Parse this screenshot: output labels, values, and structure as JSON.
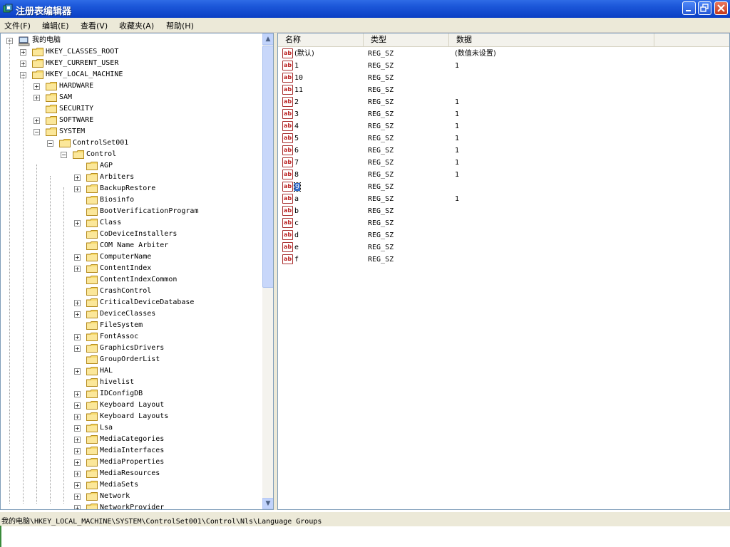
{
  "window": {
    "title": "注册表编辑器"
  },
  "menu": [
    "文件(F)",
    "编辑(E)",
    "查看(V)",
    "收藏夹(A)",
    "帮助(H)"
  ],
  "tree": [
    {
      "label": "我的电脑",
      "depth": 0,
      "exp": "-"
    },
    {
      "label": "HKEY_CLASSES_ROOT",
      "depth": 1,
      "exp": "+"
    },
    {
      "label": "HKEY_CURRENT_USER",
      "depth": 1,
      "exp": "+"
    },
    {
      "label": "HKEY_LOCAL_MACHINE",
      "depth": 1,
      "exp": "-"
    },
    {
      "label": "HARDWARE",
      "depth": 2,
      "exp": "+"
    },
    {
      "label": "SAM",
      "depth": 2,
      "exp": "+"
    },
    {
      "label": "SECURITY",
      "depth": 2,
      "exp": ""
    },
    {
      "label": "SOFTWARE",
      "depth": 2,
      "exp": "+"
    },
    {
      "label": "SYSTEM",
      "depth": 2,
      "exp": "-"
    },
    {
      "label": "ControlSet001",
      "depth": 3,
      "exp": "-"
    },
    {
      "label": "Control",
      "depth": 4,
      "exp": "-"
    },
    {
      "label": "AGP",
      "depth": 5,
      "exp": ""
    },
    {
      "label": "Arbiters",
      "depth": 5,
      "exp": "+"
    },
    {
      "label": "BackupRestore",
      "depth": 5,
      "exp": "+"
    },
    {
      "label": "Biosinfo",
      "depth": 5,
      "exp": ""
    },
    {
      "label": "BootVerificationProgram",
      "depth": 5,
      "exp": ""
    },
    {
      "label": "Class",
      "depth": 5,
      "exp": "+"
    },
    {
      "label": "CoDeviceInstallers",
      "depth": 5,
      "exp": ""
    },
    {
      "label": "COM Name Arbiter",
      "depth": 5,
      "exp": ""
    },
    {
      "label": "ComputerName",
      "depth": 5,
      "exp": "+"
    },
    {
      "label": "ContentIndex",
      "depth": 5,
      "exp": "+"
    },
    {
      "label": "ContentIndexCommon",
      "depth": 5,
      "exp": ""
    },
    {
      "label": "CrashControl",
      "depth": 5,
      "exp": ""
    },
    {
      "label": "CriticalDeviceDatabase",
      "depth": 5,
      "exp": "+"
    },
    {
      "label": "DeviceClasses",
      "depth": 5,
      "exp": "+"
    },
    {
      "label": "FileSystem",
      "depth": 5,
      "exp": ""
    },
    {
      "label": "FontAssoc",
      "depth": 5,
      "exp": "+"
    },
    {
      "label": "GraphicsDrivers",
      "depth": 5,
      "exp": "+"
    },
    {
      "label": "GroupOrderList",
      "depth": 5,
      "exp": ""
    },
    {
      "label": "HAL",
      "depth": 5,
      "exp": "+"
    },
    {
      "label": "hivelist",
      "depth": 5,
      "exp": ""
    },
    {
      "label": "IDConfigDB",
      "depth": 5,
      "exp": "+"
    },
    {
      "label": "Keyboard Layout",
      "depth": 5,
      "exp": "+"
    },
    {
      "label": "Keyboard Layouts",
      "depth": 5,
      "exp": "+"
    },
    {
      "label": "Lsa",
      "depth": 5,
      "exp": "+"
    },
    {
      "label": "MediaCategories",
      "depth": 5,
      "exp": "+"
    },
    {
      "label": "MediaInterfaces",
      "depth": 5,
      "exp": "+"
    },
    {
      "label": "MediaProperties",
      "depth": 5,
      "exp": "+"
    },
    {
      "label": "MediaResources",
      "depth": 5,
      "exp": "+"
    },
    {
      "label": "MediaSets",
      "depth": 5,
      "exp": "+"
    },
    {
      "label": "Network",
      "depth": 5,
      "exp": "+"
    },
    {
      "label": "NetworkProvider",
      "depth": 5,
      "exp": "+"
    }
  ],
  "list": {
    "headers": {
      "name": "名称",
      "type": "类型",
      "data": "数据"
    },
    "rows": [
      {
        "name": "(默认)",
        "type": "REG_SZ",
        "data": "(数值未设置)"
      },
      {
        "name": "1",
        "type": "REG_SZ",
        "data": "1"
      },
      {
        "name": "10",
        "type": "REG_SZ",
        "data": ""
      },
      {
        "name": "11",
        "type": "REG_SZ",
        "data": ""
      },
      {
        "name": "2",
        "type": "REG_SZ",
        "data": "1"
      },
      {
        "name": "3",
        "type": "REG_SZ",
        "data": "1"
      },
      {
        "name": "4",
        "type": "REG_SZ",
        "data": "1"
      },
      {
        "name": "5",
        "type": "REG_SZ",
        "data": "1"
      },
      {
        "name": "6",
        "type": "REG_SZ",
        "data": "1"
      },
      {
        "name": "7",
        "type": "REG_SZ",
        "data": "1"
      },
      {
        "name": "8",
        "type": "REG_SZ",
        "data": "1"
      },
      {
        "name": "9",
        "type": "REG_SZ",
        "data": "",
        "selected": true
      },
      {
        "name": "a",
        "type": "REG_SZ",
        "data": "1"
      },
      {
        "name": "b",
        "type": "REG_SZ",
        "data": ""
      },
      {
        "name": "c",
        "type": "REG_SZ",
        "data": ""
      },
      {
        "name": "d",
        "type": "REG_SZ",
        "data": ""
      },
      {
        "name": "e",
        "type": "REG_SZ",
        "data": ""
      },
      {
        "name": "f",
        "type": "REG_SZ",
        "data": ""
      }
    ]
  },
  "status": {
    "path": "我的电脑\\HKEY_LOCAL_MACHINE\\SYSTEM\\ControlSet001\\Control\\Nls\\Language Groups"
  },
  "icons": {
    "value": "string-value-icon",
    "folder": "folder-icon",
    "computer": "computer-icon"
  }
}
